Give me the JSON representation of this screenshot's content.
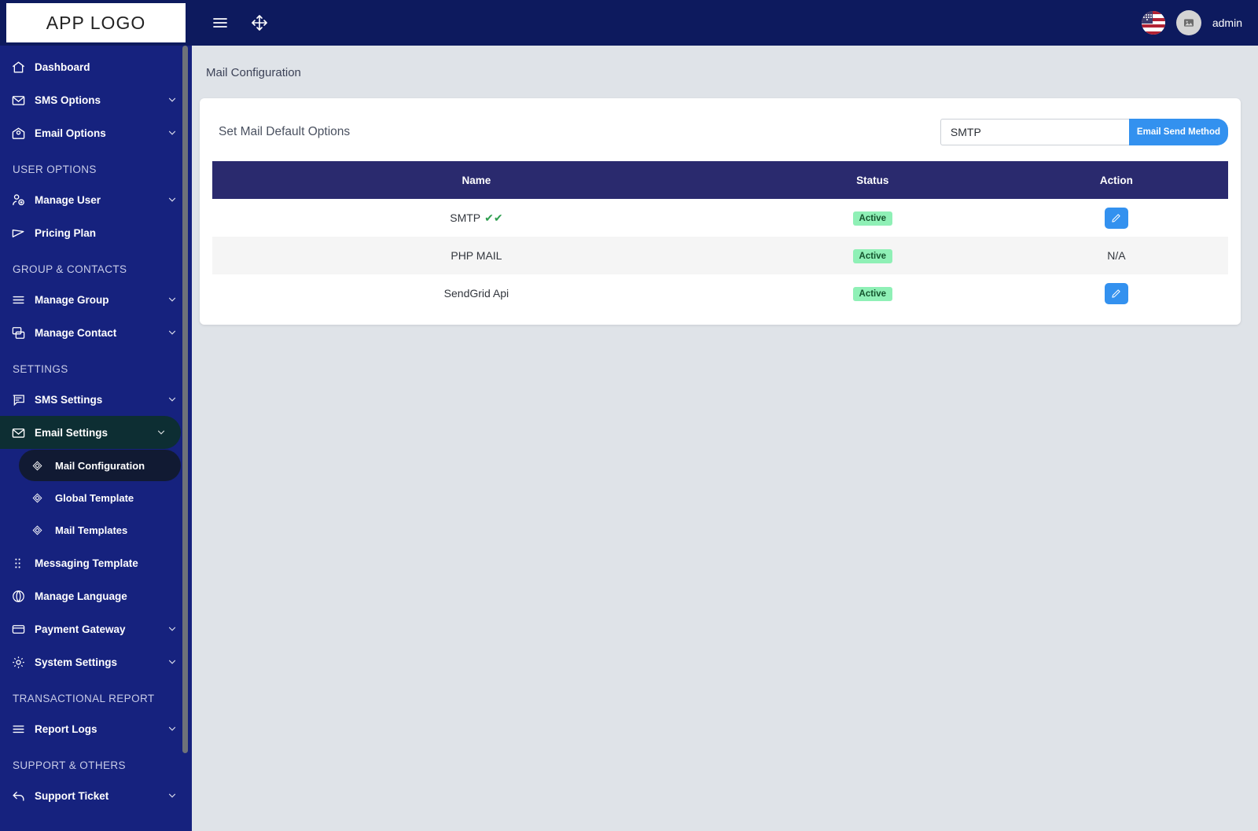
{
  "topbar": {
    "logo_text": "APP LOGO",
    "menu_icon": "hamburger-menu-icon",
    "move_icon": "move-arrows-icon",
    "flag_icon": "us-flag-icon",
    "avatar_icon": "image-placeholder-icon",
    "username": "admin"
  },
  "sidebar": {
    "items": [
      {
        "label": "Dashboard",
        "icon": "home-icon",
        "chevron": false
      },
      {
        "label": "SMS Options",
        "icon": "envelope-icon",
        "chevron": true
      },
      {
        "label": "Email Options",
        "icon": "envelope-open-icon",
        "chevron": true
      }
    ],
    "sections": [
      {
        "title": "USER OPTIONS",
        "items": [
          {
            "label": "Manage User",
            "icon": "user-add-icon",
            "chevron": true
          },
          {
            "label": "Pricing Plan",
            "icon": "send-plane-icon",
            "chevron": false
          }
        ]
      },
      {
        "title": "GROUP & CONTACTS",
        "items": [
          {
            "label": "Manage Group",
            "icon": "list-lines-icon",
            "chevron": true
          },
          {
            "label": "Manage Contact",
            "icon": "contact-card-icon",
            "chevron": true
          }
        ]
      },
      {
        "title": "SETTINGS",
        "items": [
          {
            "label": "SMS Settings",
            "icon": "chat-bubble-icon",
            "chevron": true
          },
          {
            "label": "Email Settings",
            "icon": "envelope-icon",
            "chevron": true,
            "active": true
          },
          {
            "label": "Messaging Template",
            "icon": "grid-dots-icon",
            "chevron": false
          },
          {
            "label": "Manage Language",
            "icon": "globe-icon",
            "chevron": false
          },
          {
            "label": "Payment Gateway",
            "icon": "credit-card-icon",
            "chevron": true
          },
          {
            "label": "System Settings",
            "icon": "gear-icon",
            "chevron": true
          }
        ],
        "subitems": [
          {
            "label": "Mail Configuration",
            "icon": "diamond-icon",
            "active": true
          },
          {
            "label": "Global Template",
            "icon": "diamond-icon",
            "active": false
          },
          {
            "label": "Mail Templates",
            "icon": "diamond-icon",
            "active": false
          }
        ]
      },
      {
        "title": "TRANSACTIONAL REPORT",
        "items": [
          {
            "label": "Report Logs",
            "icon": "list-lines-icon",
            "chevron": true
          }
        ]
      },
      {
        "title": "SUPPORT & OTHERS",
        "items": [
          {
            "label": "Support Ticket",
            "icon": "reply-arrow-icon",
            "chevron": true
          }
        ]
      }
    ]
  },
  "main": {
    "breadcrumb": "Mail Configuration",
    "card_title": "Set Mail Default Options",
    "mail_input_value": "SMTP",
    "mail_input_placeholder": "SMTP",
    "send_method_button": "Email Send Method",
    "table": {
      "headers": [
        "Name",
        "Status",
        "Action"
      ],
      "rows": [
        {
          "name": "SMTP",
          "default_check": "✔✔",
          "status": "Active",
          "action": "edit",
          "action_label": ""
        },
        {
          "name": "PHP MAIL",
          "default_check": "",
          "status": "Active",
          "action": "text",
          "action_label": "N/A"
        },
        {
          "name": "SendGrid Api",
          "default_check": "",
          "status": "Active",
          "action": "edit",
          "action_label": ""
        }
      ]
    }
  },
  "colors": {
    "topbar": "#0d1a5e",
    "sidebar": "#16227e",
    "table_header": "#2a2a6e",
    "accent_blue": "#3391ef",
    "badge_green": "#8ff0b6",
    "page_bg": "#dfe3e8"
  }
}
